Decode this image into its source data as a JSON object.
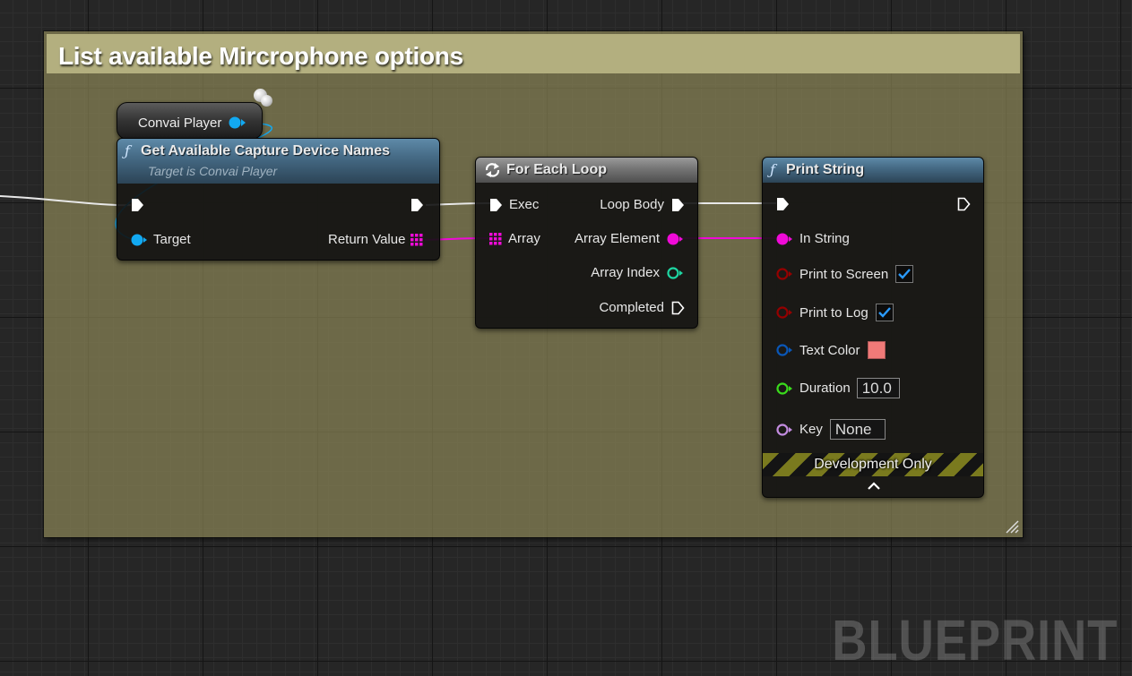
{
  "comment": {
    "title": "List available Mircrophone options",
    "color": "#b3af7f"
  },
  "variable_node": {
    "label": "Convai Player",
    "pin_color": "#12a9f2"
  },
  "get_devices_node": {
    "icon": "function-icon",
    "title": "Get Available Capture Device Names",
    "subtitle": "Target is Convai Player",
    "pins": {
      "target": "Target",
      "return_value": "Return Value"
    }
  },
  "for_each_node": {
    "icon": "loop-icon",
    "title": "For Each Loop",
    "pins": {
      "exec": "Exec",
      "array": "Array",
      "loop_body": "Loop Body",
      "array_element": "Array Element",
      "array_index": "Array Index",
      "completed": "Completed"
    }
  },
  "print_string_node": {
    "icon": "function-icon",
    "title": "Print String",
    "pins": {
      "in_string": "In String",
      "print_to_screen": "Print to Screen",
      "print_to_log": "Print to Log",
      "text_color": "Text Color",
      "duration": "Duration",
      "key": "Key"
    },
    "values": {
      "print_to_screen": true,
      "print_to_log": true,
      "text_color": "#f07a78",
      "duration": "10.0",
      "key": "None"
    },
    "banner": "Development Only"
  },
  "colors": {
    "string_pin": "#f00ad8",
    "object_pin": "#12a9f2",
    "bool_pin": "#950000",
    "struct_pin": "#0a57b8",
    "float_pin": "#3adb1c",
    "int_pin": "#1ed6a2",
    "name_pin": "#c38ce0"
  },
  "watermark": "BLUEPRINT"
}
